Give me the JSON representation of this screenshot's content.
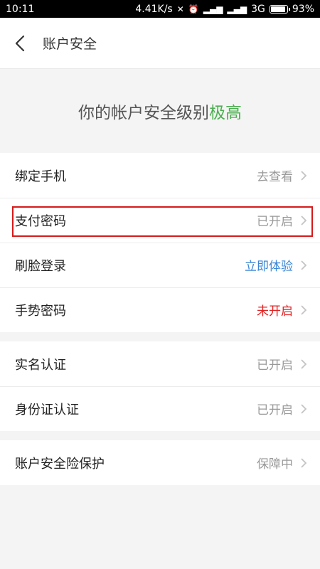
{
  "status_bar": {
    "time": "10:11",
    "speed": "4.41K/s",
    "network": "3G",
    "battery": "93%",
    "battery_level": 0.93
  },
  "nav": {
    "title": "账户安全"
  },
  "banner": {
    "prefix": "你的帐户安全级别",
    "level": "极高",
    "level_color": "#4caf50"
  },
  "groups": [
    {
      "rows": [
        {
          "label": "绑定手机",
          "status": "去查看"
        },
        {
          "label": "支付密码",
          "status": "已开启"
        },
        {
          "label": "刷脸登录",
          "status": "立即体验"
        },
        {
          "label": "手势密码",
          "status": "未开启"
        }
      ]
    },
    {
      "rows": [
        {
          "label": "实名认证",
          "status": "已开启"
        },
        {
          "label": "身份证认证",
          "status": "已开启"
        }
      ]
    },
    {
      "rows": [
        {
          "label": "账户安全险保护",
          "status": "保障中"
        }
      ]
    }
  ],
  "colors": {
    "status_gray": "#999999",
    "status_blue": "#3b87d6",
    "status_red": "#e02020",
    "highlight_red": "#d61a1a"
  }
}
